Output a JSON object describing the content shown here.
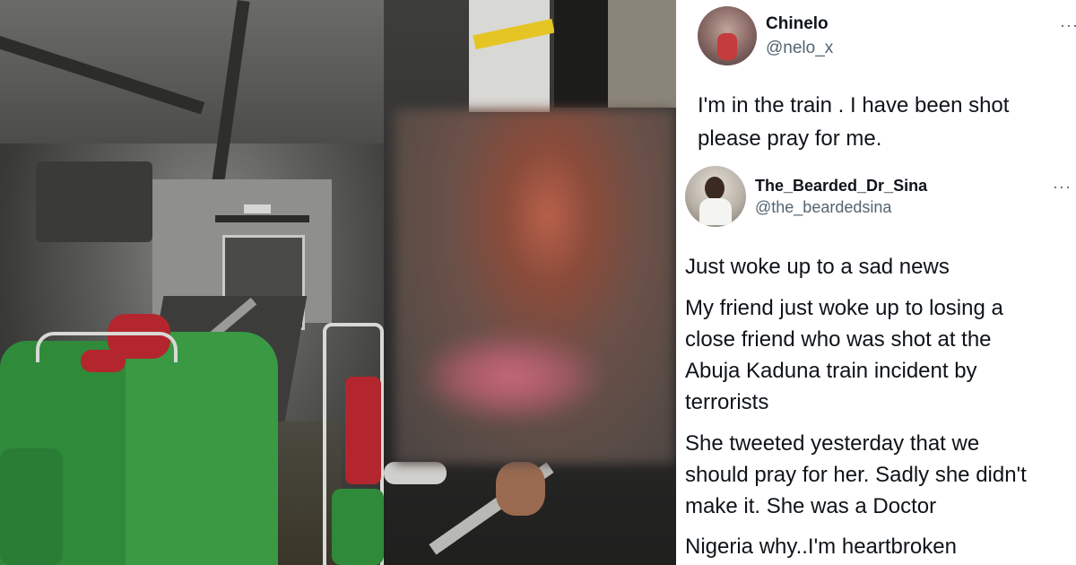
{
  "tweet1": {
    "name": "Chinelo",
    "handle": "@nelo_x",
    "more": "···",
    "text_lines": [
      "I'm in the train .  I have been shot",
      "please pray for me."
    ]
  },
  "tweet2": {
    "name": "The_Bearded_Dr_Sina",
    "handle": "@the_beardedsina",
    "more": "···",
    "paragraph1": "Just woke up to a sad news",
    "paragraph2_lines": [
      "My friend just woke up to losing a",
      "close friend who was shot at the",
      "Abuja Kaduna train incident by",
      "terrorists"
    ],
    "paragraph3_lines": [
      "She tweeted yesterday that we",
      "should pray for her. Sadly she didn't",
      "make it. She was a Doctor"
    ],
    "paragraph4": "Nigeria why..I'm heartbroken"
  },
  "colors": {
    "seat_green": "#2f8a3a",
    "seat_red": "#b3262e",
    "text_primary": "#0f1419",
    "text_secondary": "#536471"
  }
}
